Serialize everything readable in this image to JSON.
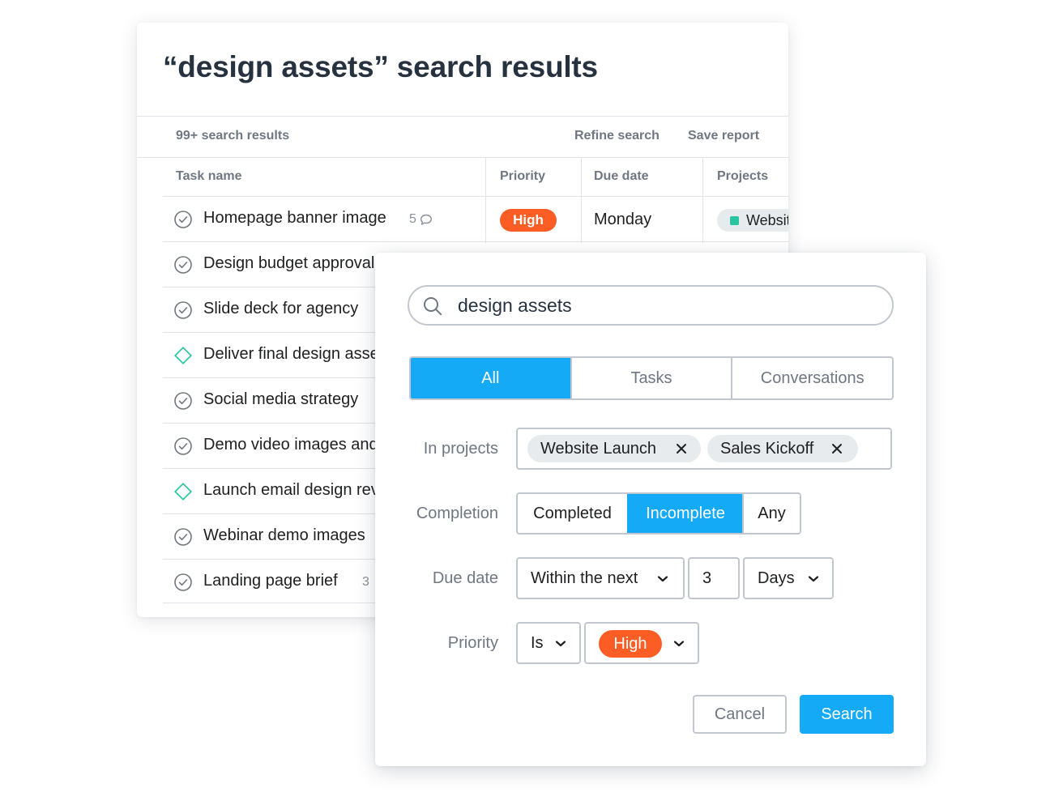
{
  "results": {
    "title": "“design assets” search results",
    "count_label": "99+ search results",
    "refine_label": "Refine search",
    "save_label": "Save report",
    "columns": {
      "task_name": "Task name",
      "priority": "Priority",
      "due_date": "Due date",
      "projects": "Projects"
    },
    "rows": [
      {
        "name": "Homepage banner image",
        "meta": "5",
        "type": "task",
        "priority": "High",
        "due": "Monday",
        "project": "Website Launch"
      },
      {
        "name": "Design budget approval",
        "meta": "",
        "type": "task"
      },
      {
        "name": "Slide deck for agency",
        "meta": "",
        "type": "task"
      },
      {
        "name": "Deliver final design assets",
        "meta": "",
        "type": "milestone"
      },
      {
        "name": "Social media strategy",
        "meta": "",
        "type": "task"
      },
      {
        "name": "Demo video images and",
        "meta": "",
        "type": "task"
      },
      {
        "name": "Launch email design review",
        "meta": "",
        "type": "milestone"
      },
      {
        "name": "Webinar demo images",
        "meta": "",
        "type": "task"
      },
      {
        "name": "Landing page brief",
        "meta": "3",
        "type": "task"
      }
    ]
  },
  "dialog": {
    "search_value": "design assets",
    "tabs": [
      {
        "label": "All",
        "active": true
      },
      {
        "label": "Tasks",
        "active": false
      },
      {
        "label": "Conversations",
        "active": false
      }
    ],
    "labels": {
      "projects": "In projects",
      "completion": "Completion",
      "due_date": "Due date",
      "priority": "Priority"
    },
    "projects": [
      "Website Launch",
      "Sales Kickoff"
    ],
    "completion": [
      {
        "label": "Completed",
        "active": false
      },
      {
        "label": "Incomplete",
        "active": true
      },
      {
        "label": "Any",
        "active": false
      }
    ],
    "due": {
      "mode": "Within the next",
      "amount": "3",
      "unit": "Days"
    },
    "priority": {
      "operator": "Is",
      "value": "High"
    },
    "cancel_label": "Cancel",
    "search_label": "Search"
  },
  "colors": {
    "accent": "#14aaf5",
    "high": "#fc5d24",
    "milestone": "#29c5a0",
    "project_dot": "#29c5a0"
  },
  "icons": {
    "task": "check-circle-icon",
    "milestone": "diamond-icon",
    "comment": "comment-icon",
    "search": "search-icon",
    "remove": "close-icon",
    "dropdown": "chevron-down-icon"
  }
}
